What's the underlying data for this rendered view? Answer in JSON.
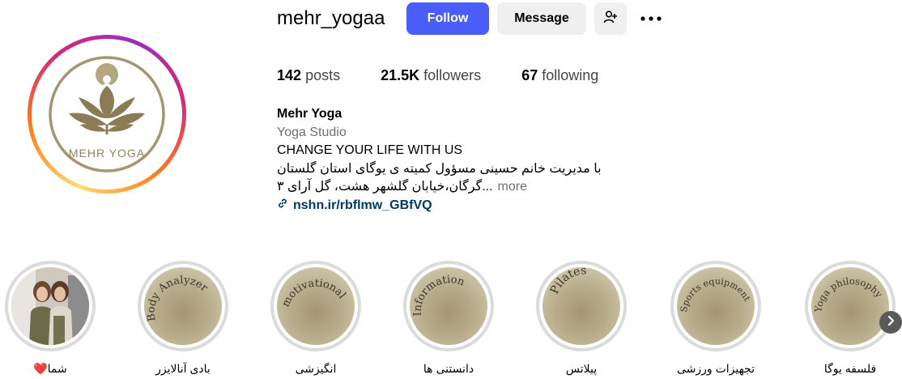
{
  "profile": {
    "username": "mehr_yogaa",
    "follow_label": "Follow",
    "message_label": "Message",
    "add_user_icon": "add-person-icon",
    "more_icon": "more-horizontal-icon",
    "avatar_logo_text": "MEHR YOGA"
  },
  "stats": {
    "posts_count": "142",
    "posts_label": "posts",
    "followers_count": "21.5K",
    "followers_label": "followers",
    "following_count": "67",
    "following_label": "following"
  },
  "bio": {
    "name": "Mehr Yoga",
    "category": "Yoga Studio",
    "line1": "CHANGE YOUR LIFE WITH US",
    "line2": "با مدیریت خانم حسینی مسؤول کمیته ی یوگای استان گلستان",
    "line3": "...گرگان،خیابان گلشهر هشت، گل آرای ۳",
    "more_label": "more",
    "link": "nshn.ir/rbflmw_GBfVQ"
  },
  "highlights": [
    {
      "label": "شما❤️",
      "cover_text": ""
    },
    {
      "label": "بادی آنالایزر",
      "cover_text": "Body Analyzer"
    },
    {
      "label": "انگیزشی",
      "cover_text": "motivational"
    },
    {
      "label": "دانستنی ها",
      "cover_text": "Information"
    },
    {
      "label": "پیلاتس",
      "cover_text": "Pilates"
    },
    {
      "label": "تجهیزات ورزشی",
      "cover_text": "Sports equipment"
    },
    {
      "label": "فلسفه یوگا",
      "cover_text": "Yoga philosophy"
    }
  ],
  "colors": {
    "follow_button": "#4a5df9",
    "secondary_button": "#efefef",
    "link": "#00376b",
    "highlight_cover": "#b3a886"
  },
  "next_icon": "chevron-right-icon"
}
